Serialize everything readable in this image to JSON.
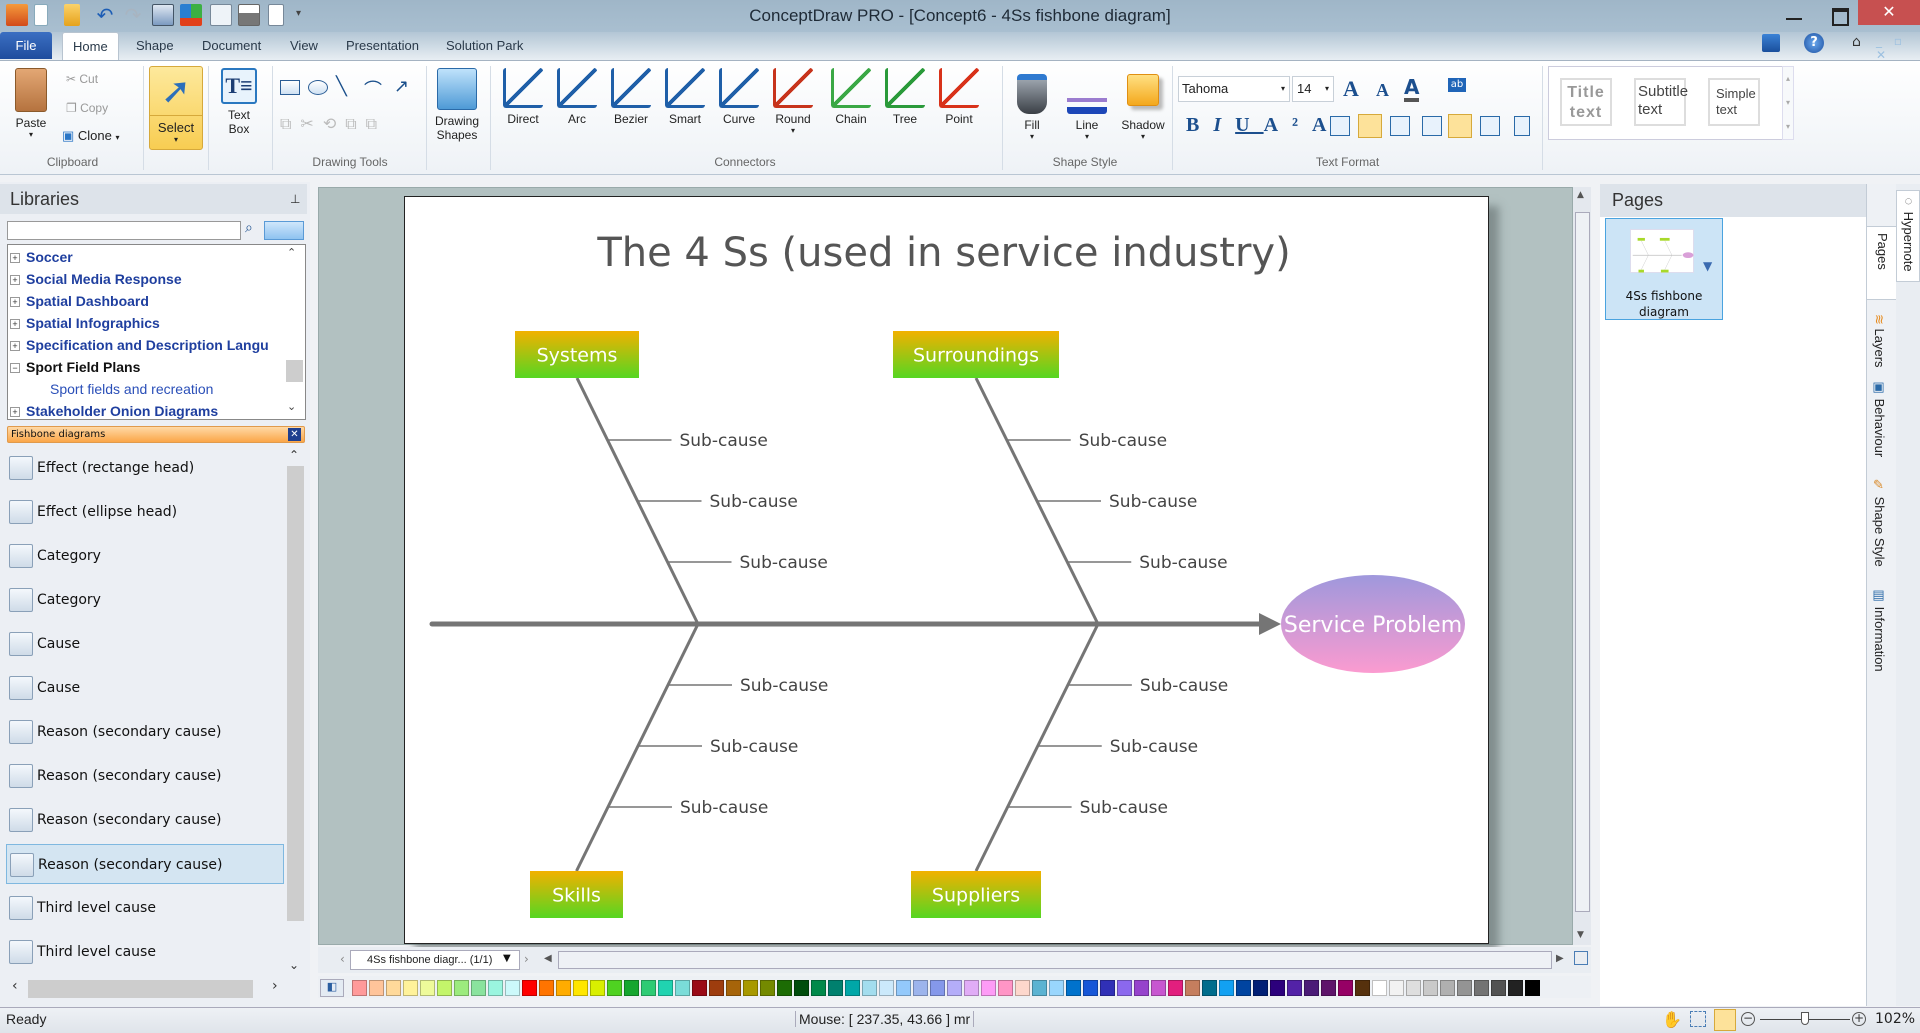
{
  "window": {
    "title": "ConceptDraw PRO - [Concept6 - 4Ss fishbone diagram]",
    "controls": {
      "minimize": "–",
      "maximize": "□",
      "close": "✕"
    }
  },
  "quick_access": [
    "app-icon",
    "new-icon",
    "open-icon",
    "undo-icon",
    "redo-icon",
    "save-icon",
    "layout-icon",
    "form-icon",
    "print-icon",
    "preview-icon",
    "customize-icon"
  ],
  "menu": {
    "tabs": [
      "File",
      "Home",
      "Shape",
      "Document",
      "View",
      "Presentation",
      "Solution Park"
    ],
    "active": "Home"
  },
  "ribbon": {
    "clipboard": {
      "paste": "Paste",
      "cut": "Cut",
      "copy": "Copy",
      "clone": "Clone",
      "label": "Clipboard"
    },
    "select": {
      "label": "Select"
    },
    "textbox": {
      "label1": "Text",
      "label2": "Box"
    },
    "drawing_tools": {
      "label": "Drawing Tools"
    },
    "drawing_shapes": {
      "label1": "Drawing",
      "label2": "Shapes"
    },
    "connectors": {
      "items": [
        "Direct",
        "Arc",
        "Bezier",
        "Smart",
        "Curve",
        "Round",
        "Chain",
        "Tree",
        "Point"
      ],
      "label": "Connectors"
    },
    "shape_style": {
      "items": [
        "Fill",
        "Line",
        "Shadow"
      ],
      "label": "Shape Style"
    },
    "text_format": {
      "font": "Tahoma",
      "size": "14",
      "label": "Text Format"
    },
    "text_styles": [
      "Title text",
      "Subtitle text",
      "Simple text"
    ]
  },
  "libraries": {
    "title": "Libraries",
    "search_placeholder": "",
    "tree": [
      {
        "label": "Soccer",
        "state": "+"
      },
      {
        "label": "Social Media Response",
        "state": "+"
      },
      {
        "label": "Spatial Dashboard",
        "state": "+"
      },
      {
        "label": "Spatial Infographics",
        "state": "+"
      },
      {
        "label": "Specification and Description Langu",
        "state": "+"
      },
      {
        "label": "Sport Field Plans",
        "state": "−"
      },
      {
        "label": "Sport fields and recreation",
        "state": ""
      },
      {
        "label": "Stakeholder Onion Diagrams",
        "state": "+"
      }
    ],
    "open_library": "Fishbone diagrams",
    "shapes": [
      "Effect (rectange head)",
      "Effect (ellipse head)",
      "Category",
      "Category",
      "Cause",
      "Cause",
      "Reason (secondary cause)",
      "Reason (secondary cause)",
      "Reason (secondary cause)",
      "Reason (secondary cause)",
      "Third level cause",
      "Third level cause"
    ],
    "selected_shape_index": 9
  },
  "diagram": {
    "title": "The 4 Ss (used in service industry)",
    "effect": "Service Problem",
    "categories": [
      {
        "name": "Systems",
        "position": "top",
        "causes": [
          "Sub-cause",
          "Sub-cause",
          "Sub-cause"
        ]
      },
      {
        "name": "Surroundings",
        "position": "top",
        "causes": [
          "Sub-cause",
          "Sub-cause",
          "Sub-cause"
        ]
      },
      {
        "name": "Skills",
        "position": "bottom",
        "causes": [
          "Sub-cause",
          "Sub-cause",
          "Sub-cause"
        ]
      },
      {
        "name": "Suppliers",
        "position": "bottom",
        "causes": [
          "Sub-cause",
          "Sub-cause",
          "Sub-cause"
        ]
      }
    ],
    "colors": {
      "category_top": "#f2b100",
      "category_bottom": "#55d622",
      "effect_top": "#9f98dc",
      "effect_bottom": "#fb9bd0",
      "line": "#757575",
      "text": "#444444"
    }
  },
  "canvas": {
    "page_selector": "4Ss fishbone diagr... (1/1)"
  },
  "palette": [
    "#ff9a9a",
    "#ffc49a",
    "#ffd99a",
    "#fff29a",
    "#eefa9a",
    "#c3f56a",
    "#9ceb7e",
    "#8ae39e",
    "#9af5df",
    "#ccf9fa",
    "#ff0000",
    "#ff7400",
    "#ffac00",
    "#ffe600",
    "#d9ef00",
    "#4fd221",
    "#16a62f",
    "#2ecb74",
    "#20d3b0",
    "#7adcd8",
    "#9a0a16",
    "#9e3d0e",
    "#a66409",
    "#a89900",
    "#748a00",
    "#1c6c04",
    "#004d0c",
    "#00894a",
    "#00806e",
    "#00a7a8",
    "#a3ddee",
    "#cbe9fb",
    "#93c9fb",
    "#9cb4ec",
    "#8598ea",
    "#b4adf9",
    "#e0acf6",
    "#fd9cf6",
    "#ff95c6",
    "#fdd7cc",
    "#5bb3d2",
    "#99d6fd",
    "#0072cc",
    "#1757d7",
    "#3030b6",
    "#8b68ee",
    "#9643cc",
    "#c757d0",
    "#e21f7e",
    "#c57e5e",
    "#006d8c",
    "#12a1f2",
    "#0044a0",
    "#001f75",
    "#2c007c",
    "#5322a7",
    "#4b1b77",
    "#5e146a",
    "#960065",
    "#56310d",
    "#ffffff",
    "#f2f2f2",
    "#dedede",
    "#c9c9c9",
    "#b0b0b0",
    "#949494",
    "#737373",
    "#525252",
    "#222222",
    "#000000"
  ],
  "pages_panel": {
    "title": "Pages",
    "pages": [
      {
        "label": "4Ss fishbone diagram"
      }
    ]
  },
  "side_tabs": [
    "Pages",
    "Layers",
    "Behaviour",
    "Shape Style",
    "Information"
  ],
  "hypernote_tab": "Hypernote",
  "status": {
    "ready": "Ready",
    "mouse": "Mouse: [ 237.35, 43.66 ] mr",
    "zoom": "102%",
    "zoom_fraction": 0.5
  }
}
